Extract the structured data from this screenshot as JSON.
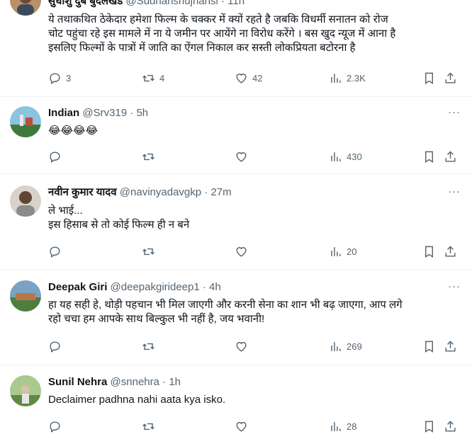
{
  "tweets": [
    {
      "name": "सुधांशु दुबे बुंदेलखंड",
      "handle": "@Sudhanshujhansi",
      "time": "11h",
      "lines": [
        "ये तथाकथित ठेकेदार हमेशा फिल्म के चक्कर में क्यों रहते है जबकि विधर्मी सनातन को रोज",
        "चोट पहुंचा रहे इस मामले में ना ये जमीन पर आयेंगे ना विरोध करेंगे । बस खुद न्यूज में आना है",
        "इसलिए फिल्मों के पात्रों में जाति का ऐंगल निकाल कर सस्ती लोकप्रियता बटोरना है"
      ],
      "replies": "3",
      "retweets": "4",
      "likes": "42",
      "views": "2.3K",
      "avatar_color": "#c9a27a"
    },
    {
      "name": "Indian",
      "handle": "@Srv319",
      "time": "5h",
      "lines": [
        "😂😂😂😂"
      ],
      "replies": "",
      "retweets": "",
      "likes": "",
      "views": "430",
      "avatar_color": "#7fb7d6"
    },
    {
      "name": "नवीन कुमार यादव",
      "handle": "@navinyadavgkp",
      "time": "27m",
      "lines": [
        "ले भाई...",
        "इस हिसाब से तो कोई फिल्म ही न बने"
      ],
      "replies": "",
      "retweets": "",
      "likes": "",
      "views": "20",
      "avatar_color": "#9a8a78"
    },
    {
      "name": "Deepak Giri",
      "handle": "@deepakgirideep1",
      "time": "4h",
      "lines": [
        "हा यह सही हे, थोड़ी पहचान भी मिल जाएगी और करनी सेना का शान भी बढ़ जाएगा, आप लगे",
        "रहो  चचा हम आपके साथ बिल्कुल भी नहीं है, जय भवानी!"
      ],
      "replies": "",
      "retweets": "",
      "likes": "",
      "views": "269",
      "avatar_color": "#6f9a5a"
    },
    {
      "name": "Sunil Nehra",
      "handle": "@snnehra",
      "time": "1h",
      "lines": [
        "Declaimer padhna nahi aata kya isko."
      ],
      "replies": "",
      "retweets": "",
      "likes": "",
      "views": "28",
      "avatar_color": "#7da36a"
    }
  ],
  "icons": {
    "reply": "reply-icon",
    "retweet": "retweet-icon",
    "like": "heart-icon",
    "views": "views-icon",
    "bookmark": "bookmark-icon",
    "share": "share-icon",
    "more": "more-icon"
  },
  "more_glyph": "···",
  "sep": "·"
}
